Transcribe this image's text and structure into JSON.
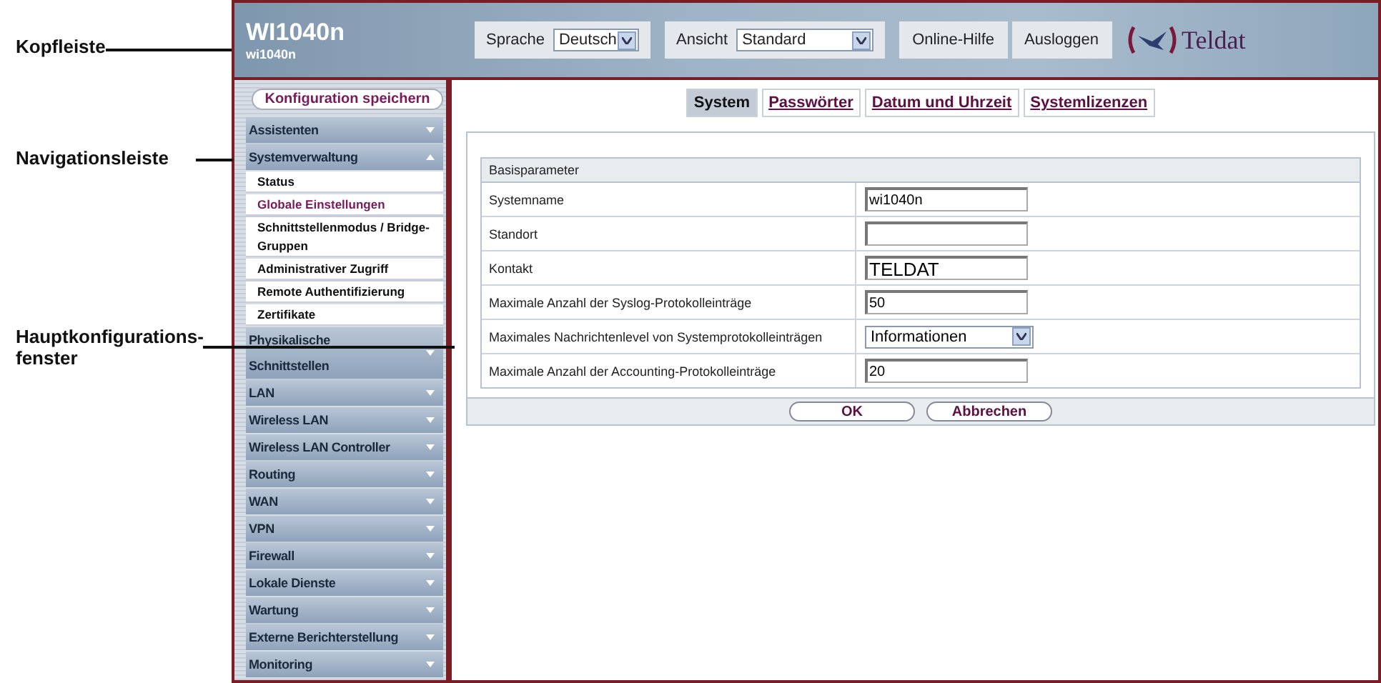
{
  "annotations": [
    {
      "label": "Kopfleiste"
    },
    {
      "label": "Navigationsleiste"
    },
    {
      "label": "Hauptkonfigurations-fenster"
    }
  ],
  "header": {
    "title": "WI1040n",
    "subtitle": "wi1040n",
    "language": {
      "label": "Sprache",
      "value": "Deutsch"
    },
    "view": {
      "label": "Ansicht",
      "value": "Standard"
    },
    "buttons": [
      "Online-Hilfe",
      "Ausloggen"
    ],
    "logo": "Teldat"
  },
  "sidebar": {
    "save_button": "Konfiguration speichern",
    "items": [
      {
        "label": "Assistenten",
        "expanded": false
      },
      {
        "label": "Systemverwaltung",
        "expanded": true,
        "children": [
          {
            "label": "Status",
            "selected": false
          },
          {
            "label": "Globale Einstellungen",
            "selected": true
          },
          {
            "label": "Schnittstellenmodus / Bridge-Gruppen",
            "selected": false
          },
          {
            "label": "Administrativer Zugriff",
            "selected": false
          },
          {
            "label": "Remote Authentifizierung",
            "selected": false
          },
          {
            "label": "Zertifikate",
            "selected": false
          }
        ]
      },
      {
        "label": "Physikalische Schnittstellen",
        "expanded": false
      },
      {
        "label": "LAN",
        "expanded": false
      },
      {
        "label": "Wireless LAN",
        "expanded": false
      },
      {
        "label": "Wireless LAN Controller",
        "expanded": false
      },
      {
        "label": "Routing",
        "expanded": false
      },
      {
        "label": "WAN",
        "expanded": false
      },
      {
        "label": "VPN",
        "expanded": false
      },
      {
        "label": "Firewall",
        "expanded": false
      },
      {
        "label": "Lokale Dienste",
        "expanded": false
      },
      {
        "label": "Wartung",
        "expanded": false
      },
      {
        "label": "Externe Berichterstellung",
        "expanded": false
      },
      {
        "label": "Monitoring",
        "expanded": false
      }
    ]
  },
  "tabs": [
    {
      "label": "System",
      "selected": true
    },
    {
      "label": "Passwörter",
      "selected": false
    },
    {
      "label": "Datum und Uhrzeit",
      "selected": false
    },
    {
      "label": "Systemlizenzen",
      "selected": false
    }
  ],
  "section": {
    "title": "Basisparameter",
    "rows": [
      {
        "label": "Systemname",
        "kind": "input",
        "value": "wi1040n"
      },
      {
        "label": "Standort",
        "kind": "input"
      },
      {
        "label": "Kontakt",
        "kind": "input",
        "value": "TELDAT",
        "large": true
      },
      {
        "label": "Maximale Anzahl der Syslog-Protokolleinträge",
        "kind": "input",
        "value": "50"
      },
      {
        "label": "Maximales Nachrichtenlevel von Systemprotokolleinträgen",
        "kind": "select",
        "value": "Informationen"
      },
      {
        "label": "Maximale Anzahl der Accounting-Protokolleinträge",
        "kind": "input",
        "value": "20"
      }
    ]
  },
  "buttons": [
    "OK",
    "Abbrechen"
  ]
}
